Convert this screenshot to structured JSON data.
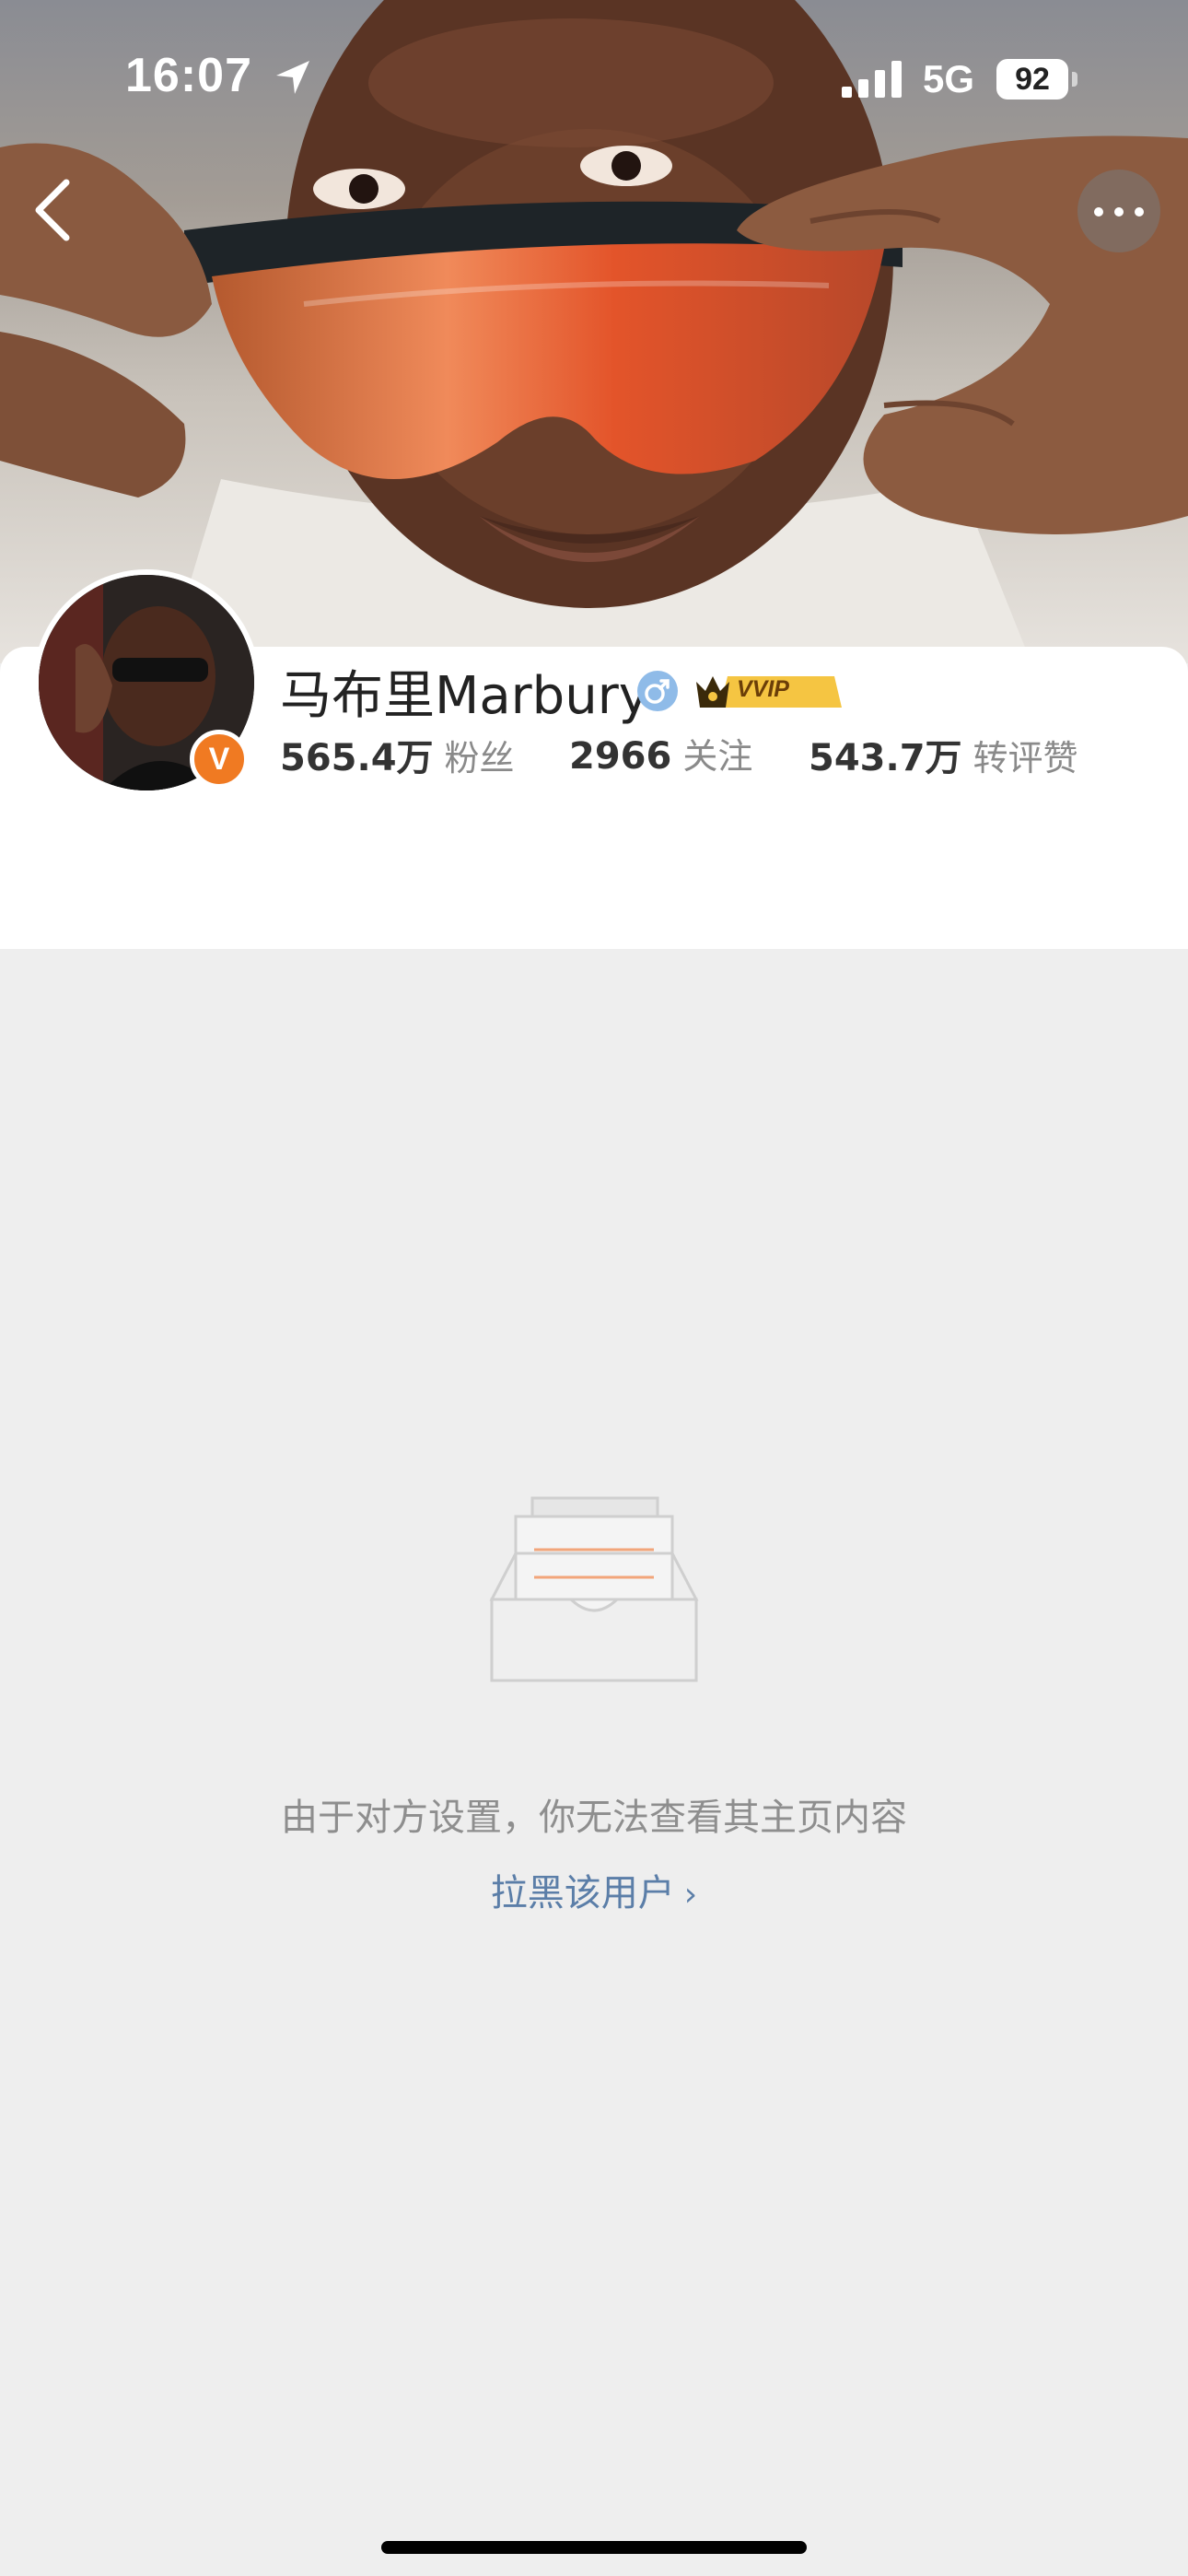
{
  "status_bar": {
    "time": "16:07",
    "network": "5G",
    "battery": "92"
  },
  "profile": {
    "name": "马布里Marbury",
    "vip_badge": "VVIP",
    "verified_badge": "V",
    "stats": [
      {
        "value": "565.4万",
        "label": "粉丝"
      },
      {
        "value": "2966",
        "label": "关注"
      },
      {
        "value": "543.7万",
        "label": "转评赞"
      }
    ]
  },
  "empty_state": {
    "message": "由于对方设置，你无法查看其主页内容",
    "action": "拉黑该用户",
    "chevron": "›"
  },
  "icons": [
    "back-arrow-icon",
    "more-icon",
    "location-arrow-icon",
    "signal-icon",
    "gender-male-icon",
    "crown-icon",
    "empty-inbox-icon"
  ],
  "colors": {
    "accent_link": "#5b7ea8",
    "verified_orange": "#f07a22",
    "background": "#eeeeee"
  }
}
